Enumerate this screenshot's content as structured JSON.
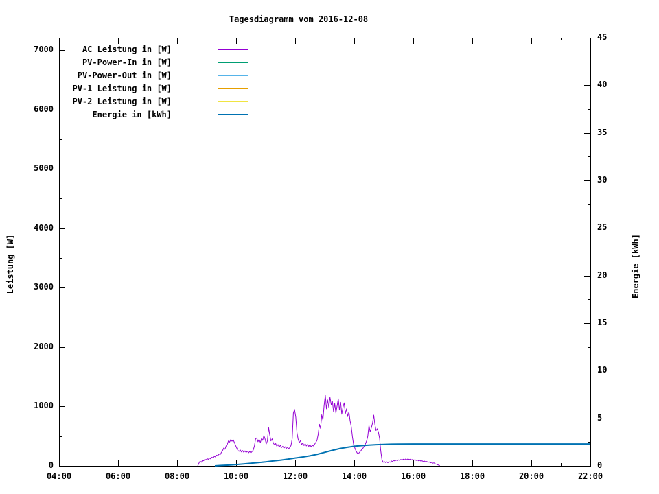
{
  "title": "Tagesdiagramm vom 2016-12-08",
  "chart_data": {
    "type": "line",
    "title": "Tagesdiagramm vom 2016-12-08",
    "grid": false,
    "legend_position": "top-left-inside",
    "background": "#ffffff",
    "frame_color": "#000000",
    "x_axis": {
      "label": "",
      "range": [
        4,
        22
      ],
      "minor_step_hours": 1,
      "ticks": [
        {
          "t": 4,
          "label": "04:00"
        },
        {
          "t": 6,
          "label": "06:00"
        },
        {
          "t": 8,
          "label": "08:00"
        },
        {
          "t": 10,
          "label": "10:00"
        },
        {
          "t": 12,
          "label": "12:00"
        },
        {
          "t": 14,
          "label": "14:00"
        },
        {
          "t": 16,
          "label": "16:00"
        },
        {
          "t": 18,
          "label": "18:00"
        },
        {
          "t": 20,
          "label": "20:00"
        },
        {
          "t": 22,
          "label": "22:00"
        }
      ]
    },
    "y_left": {
      "label": "Leistung [W]",
      "range": [
        0,
        7208
      ],
      "major_step": 1000,
      "minor_step": 500,
      "ticks": [
        {
          "v": 0,
          "label": "0"
        },
        {
          "v": 1000,
          "label": "1000"
        },
        {
          "v": 2000,
          "label": "2000"
        },
        {
          "v": 3000,
          "label": "3000"
        },
        {
          "v": 4000,
          "label": "4000"
        },
        {
          "v": 5000,
          "label": "5000"
        },
        {
          "v": 6000,
          "label": "6000"
        },
        {
          "v": 7000,
          "label": "7000"
        }
      ]
    },
    "y_right": {
      "label": "Energie [kWh]",
      "range": [
        0,
        45
      ],
      "major_step": 5,
      "minor_step": 2.5,
      "ticks": [
        {
          "v": 0,
          "label": "0"
        },
        {
          "v": 5,
          "label": "5"
        },
        {
          "v": 10,
          "label": "10"
        },
        {
          "v": 15,
          "label": "15"
        },
        {
          "v": 20,
          "label": "20"
        },
        {
          "v": 25,
          "label": "25"
        },
        {
          "v": 30,
          "label": "30"
        },
        {
          "v": 35,
          "label": "35"
        },
        {
          "v": 40,
          "label": "40"
        },
        {
          "v": 45,
          "label": "45"
        }
      ]
    },
    "series": [
      {
        "name": "AC Leistung in [W]",
        "color": "#9400d3",
        "axis": "left",
        "width": 1,
        "points": [
          [
            8.7,
            0
          ],
          [
            8.74,
            45
          ],
          [
            8.78,
            80
          ],
          [
            8.82,
            60
          ],
          [
            8.86,
            95
          ],
          [
            8.9,
            85
          ],
          [
            8.94,
            110
          ],
          [
            8.98,
            100
          ],
          [
            9.02,
            120
          ],
          [
            9.06,
            110
          ],
          [
            9.1,
            130
          ],
          [
            9.14,
            118
          ],
          [
            9.18,
            145
          ],
          [
            9.22,
            132
          ],
          [
            9.26,
            160
          ],
          [
            9.3,
            150
          ],
          [
            9.34,
            180
          ],
          [
            9.38,
            170
          ],
          [
            9.42,
            200
          ],
          [
            9.46,
            190
          ],
          [
            9.5,
            225
          ],
          [
            9.54,
            255
          ],
          [
            9.58,
            300
          ],
          [
            9.62,
            280
          ],
          [
            9.66,
            335
          ],
          [
            9.7,
            360
          ],
          [
            9.74,
            420
          ],
          [
            9.78,
            400
          ],
          [
            9.82,
            445
          ],
          [
            9.86,
            415
          ],
          [
            9.9,
            440
          ],
          [
            9.94,
            395
          ],
          [
            9.98,
            345
          ],
          [
            10.02,
            300
          ],
          [
            10.06,
            260
          ],
          [
            10.1,
            245
          ],
          [
            10.14,
            268
          ],
          [
            10.18,
            235
          ],
          [
            10.22,
            258
          ],
          [
            10.26,
            228
          ],
          [
            10.3,
            252
          ],
          [
            10.34,
            224
          ],
          [
            10.38,
            248
          ],
          [
            10.42,
            220
          ],
          [
            10.46,
            242
          ],
          [
            10.5,
            218
          ],
          [
            10.54,
            240
          ],
          [
            10.58,
            265
          ],
          [
            10.62,
            340
          ],
          [
            10.66,
            455
          ],
          [
            10.7,
            470
          ],
          [
            10.74,
            405
          ],
          [
            10.78,
            445
          ],
          [
            10.82,
            392
          ],
          [
            10.86,
            462
          ],
          [
            10.9,
            430
          ],
          [
            10.94,
            510
          ],
          [
            10.98,
            455
          ],
          [
            11.02,
            370
          ],
          [
            11.06,
            420
          ],
          [
            11.1,
            650
          ],
          [
            11.14,
            520
          ],
          [
            11.18,
            420
          ],
          [
            11.22,
            455
          ],
          [
            11.26,
            385
          ],
          [
            11.3,
            352
          ],
          [
            11.34,
            375
          ],
          [
            11.38,
            330
          ],
          [
            11.42,
            358
          ],
          [
            11.46,
            318
          ],
          [
            11.5,
            345
          ],
          [
            11.54,
            308
          ],
          [
            11.58,
            330
          ],
          [
            11.62,
            298
          ],
          [
            11.66,
            322
          ],
          [
            11.7,
            292
          ],
          [
            11.74,
            315
          ],
          [
            11.78,
            288
          ],
          [
            11.82,
            310
          ],
          [
            11.86,
            345
          ],
          [
            11.9,
            460
          ],
          [
            11.94,
            890
          ],
          [
            11.98,
            950
          ],
          [
            12.02,
            820
          ],
          [
            12.06,
            560
          ],
          [
            12.1,
            450
          ],
          [
            12.14,
            392
          ],
          [
            12.18,
            425
          ],
          [
            12.22,
            358
          ],
          [
            12.26,
            388
          ],
          [
            12.3,
            342
          ],
          [
            12.34,
            372
          ],
          [
            12.38,
            335
          ],
          [
            12.42,
            362
          ],
          [
            12.46,
            328
          ],
          [
            12.5,
            352
          ],
          [
            12.54,
            322
          ],
          [
            12.58,
            345
          ],
          [
            12.62,
            335
          ],
          [
            12.66,
            365
          ],
          [
            12.7,
            395
          ],
          [
            12.74,
            430
          ],
          [
            12.78,
            530
          ],
          [
            12.82,
            700
          ],
          [
            12.86,
            630
          ],
          [
            12.9,
            860
          ],
          [
            12.94,
            770
          ],
          [
            12.98,
            1010
          ],
          [
            13.02,
            1190
          ],
          [
            13.06,
            960
          ],
          [
            13.1,
            1110
          ],
          [
            13.14,
            985
          ],
          [
            13.18,
            1155
          ],
          [
            13.22,
            1030
          ],
          [
            13.26,
            1090
          ],
          [
            13.3,
            910
          ],
          [
            13.34,
            1050
          ],
          [
            13.38,
            890
          ],
          [
            13.42,
            1010
          ],
          [
            13.46,
            1130
          ],
          [
            13.5,
            940
          ],
          [
            13.54,
            1070
          ],
          [
            13.58,
            870
          ],
          [
            13.62,
            990
          ],
          [
            13.66,
            1060
          ],
          [
            13.7,
            880
          ],
          [
            13.74,
            960
          ],
          [
            13.78,
            830
          ],
          [
            13.82,
            910
          ],
          [
            13.86,
            760
          ],
          [
            13.9,
            660
          ],
          [
            13.94,
            490
          ],
          [
            13.98,
            360
          ],
          [
            14.02,
            300
          ],
          [
            14.06,
            252
          ],
          [
            14.1,
            218
          ],
          [
            14.14,
            202
          ],
          [
            14.18,
            228
          ],
          [
            14.22,
            252
          ],
          [
            14.26,
            278
          ],
          [
            14.3,
            300
          ],
          [
            14.34,
            330
          ],
          [
            14.38,
            368
          ],
          [
            14.42,
            420
          ],
          [
            14.46,
            500
          ],
          [
            14.5,
            680
          ],
          [
            14.54,
            575
          ],
          [
            14.58,
            640
          ],
          [
            14.62,
            720
          ],
          [
            14.66,
            855
          ],
          [
            14.7,
            700
          ],
          [
            14.74,
            595
          ],
          [
            14.78,
            625
          ],
          [
            14.82,
            565
          ],
          [
            14.86,
            460
          ],
          [
            14.9,
            250
          ],
          [
            14.94,
            105
          ],
          [
            14.98,
            60
          ],
          [
            15.02,
            72
          ],
          [
            15.06,
            55
          ],
          [
            15.1,
            68
          ],
          [
            15.14,
            52
          ],
          [
            15.18,
            70
          ],
          [
            15.22,
            60
          ],
          [
            15.26,
            82
          ],
          [
            15.3,
            72
          ],
          [
            15.34,
            92
          ],
          [
            15.38,
            80
          ],
          [
            15.42,
            98
          ],
          [
            15.46,
            86
          ],
          [
            15.5,
            100
          ],
          [
            15.54,
            92
          ],
          [
            15.58,
            108
          ],
          [
            15.62,
            96
          ],
          [
            15.66,
            112
          ],
          [
            15.7,
            100
          ],
          [
            15.74,
            115
          ],
          [
            15.78,
            104
          ],
          [
            15.82,
            118
          ],
          [
            15.86,
            106
          ],
          [
            15.9,
            112
          ],
          [
            15.94,
            100
          ],
          [
            15.98,
            108
          ],
          [
            16.02,
            96
          ],
          [
            16.06,
            104
          ],
          [
            16.1,
            90
          ],
          [
            16.14,
            98
          ],
          [
            16.18,
            84
          ],
          [
            16.22,
            92
          ],
          [
            16.26,
            78
          ],
          [
            16.3,
            86
          ],
          [
            16.34,
            72
          ],
          [
            16.38,
            80
          ],
          [
            16.42,
            66
          ],
          [
            16.46,
            74
          ],
          [
            16.5,
            58
          ],
          [
            16.54,
            66
          ],
          [
            16.58,
            50
          ],
          [
            16.62,
            58
          ],
          [
            16.66,
            44
          ],
          [
            16.7,
            50
          ],
          [
            16.74,
            36
          ],
          [
            16.78,
            28
          ],
          [
            16.82,
            20
          ],
          [
            16.86,
            12
          ],
          [
            16.9,
            5
          ]
        ]
      },
      {
        "name": "PV-Power-In in [W]",
        "color": "#009e73",
        "axis": "left",
        "width": 1,
        "points": []
      },
      {
        "name": "PV-Power-Out in [W]",
        "color": "#56b4e9",
        "axis": "left",
        "width": 1,
        "points": []
      },
      {
        "name": "PV-1 Leistung in [W]",
        "color": "#e69f00",
        "axis": "left",
        "width": 1,
        "points": []
      },
      {
        "name": "PV-2 Leistung in [W]",
        "color": "#f0e442",
        "axis": "left",
        "width": 1,
        "points": []
      },
      {
        "name": "Energie in [kWh]",
        "color": "#0072b2",
        "axis": "right",
        "width": 2,
        "points": [
          [
            9.28,
            0.0
          ],
          [
            9.5,
            0.04
          ],
          [
            9.75,
            0.08
          ],
          [
            10.0,
            0.14
          ],
          [
            10.25,
            0.2
          ],
          [
            10.5,
            0.27
          ],
          [
            10.75,
            0.34
          ],
          [
            11.0,
            0.42
          ],
          [
            11.25,
            0.51
          ],
          [
            11.5,
            0.6
          ],
          [
            11.75,
            0.7
          ],
          [
            12.0,
            0.82
          ],
          [
            12.25,
            0.93
          ],
          [
            12.5,
            1.05
          ],
          [
            12.75,
            1.22
          ],
          [
            13.0,
            1.42
          ],
          [
            13.25,
            1.62
          ],
          [
            13.5,
            1.81
          ],
          [
            13.75,
            1.95
          ],
          [
            14.0,
            2.06
          ],
          [
            14.25,
            2.13
          ],
          [
            14.5,
            2.18
          ],
          [
            14.75,
            2.23
          ],
          [
            15.0,
            2.26
          ],
          [
            15.25,
            2.28
          ],
          [
            15.5,
            2.29
          ],
          [
            16.0,
            2.3
          ],
          [
            17.0,
            2.3
          ],
          [
            18.0,
            2.3
          ],
          [
            19.0,
            2.3
          ],
          [
            20.0,
            2.3
          ],
          [
            21.0,
            2.3
          ],
          [
            22.0,
            2.3
          ]
        ]
      }
    ]
  }
}
